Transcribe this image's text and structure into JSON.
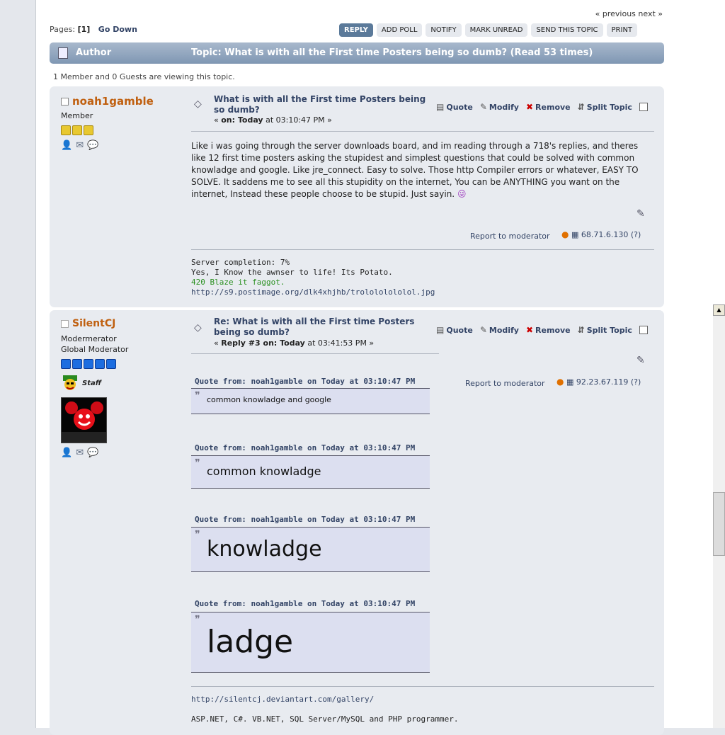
{
  "nav": {
    "prev_next": "« previous next »"
  },
  "pages_label": "Pages:",
  "pages_current": "[1]",
  "go_down": "Go Down",
  "buttons": [
    "REPLY",
    "ADD POLL",
    "NOTIFY",
    "MARK UNREAD",
    "SEND THIS TOPIC",
    "PRINT"
  ],
  "header": {
    "author": "Author",
    "topic": "Topic: What is with all the First time Posters being so dumb?  (Read 53 times)"
  },
  "viewing": "1 Member and 0 Guests are viewing this topic.",
  "actions": [
    "Quote",
    "Modify",
    "Remove",
    "Split Topic"
  ],
  "posts": [
    {
      "username": "noah1gamble",
      "rank": "Member",
      "title_line1": "What is with all the First time Posters being",
      "title_line2": "so dumb?",
      "date_prefix": "« ",
      "date_bold": "on: Today",
      "date_rest": " at 03:10:47 PM »",
      "body": "Like i was going through the server downloads board, and im reading through a 718's replies, and theres like 12 first time posters asking the stupidest and simplest questions that could be solved with common knowladge and google. Like jre_connect. Easy to solve. Those http Compiler errors or whatever, EASY TO SOLVE. It saddens me to see all this stupidity on the internet, You can be ANYTHING you want on the internet, Instead these people choose to be stupid. Just sayin.",
      "report": "Report to moderator",
      "ip": "68.71.6.130 (?)",
      "sig_lines": [
        "Server completion: 7%",
        "Yes, I Know the awnser to life! Its Potato.",
        "420 Blaze it faggot.",
        "http://s9.postimage.org/dlk4xhjhb/trolololololol.jpg"
      ]
    },
    {
      "username": "SilentCJ",
      "rank": "Modermerator",
      "group": "Global Moderator",
      "staff": "Staff",
      "title_line1": "Re: What is with all the First time Posters",
      "title_line2": "being so dumb?",
      "date_prefix": "« ",
      "date_bold": "Reply #3 on: Today",
      "date_rest": " at 03:41:53 PM »",
      "report": "Report to moderator",
      "ip": "92.23.67.119 (?)",
      "quotes": [
        {
          "head": "Quote from: noah1gamble on Today at 03:10:47 PM",
          "text": "common knowladge and google"
        },
        {
          "head": "Quote from: noah1gamble on Today at 03:10:47 PM",
          "text": "common knowladge"
        },
        {
          "head": "Quote from: noah1gamble on Today at 03:10:47 PM",
          "text": "knowladge"
        },
        {
          "head": "Quote from: noah1gamble on Today at 03:10:47 PM",
          "text": "ladge"
        }
      ],
      "sig_link": "http://silentcj.deviantart.com/gallery/",
      "sig_text": "ASP.NET, C#. VB.NET, SQL Server/MySQL and PHP programmer."
    }
  ]
}
